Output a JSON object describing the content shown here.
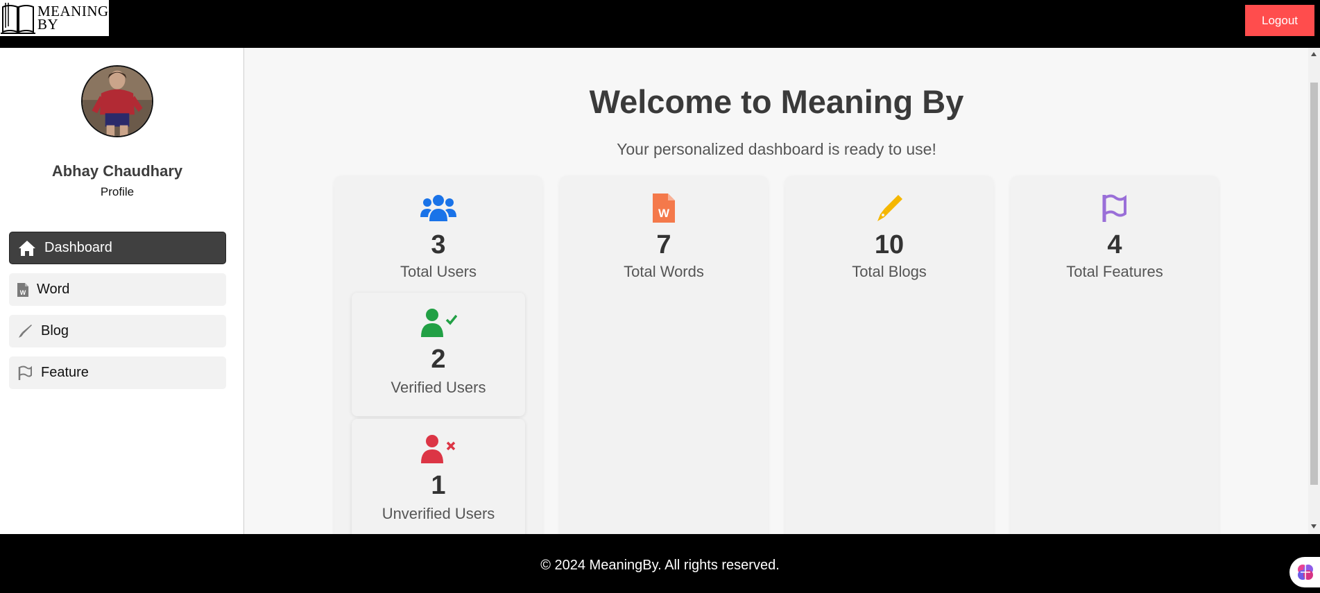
{
  "header": {
    "logo_line1": "MEANING",
    "logo_line2": "BY",
    "logout_label": "Logout"
  },
  "sidebar": {
    "user_name": "Abhay Chaudhary",
    "profile_label": "Profile",
    "items": [
      {
        "label": "Dashboard",
        "icon": "home-icon",
        "active": true
      },
      {
        "label": "Word",
        "icon": "word-file-icon",
        "active": false
      },
      {
        "label": "Blog",
        "icon": "pen-icon",
        "active": false
      },
      {
        "label": "Feature",
        "icon": "flag-icon",
        "active": false
      }
    ]
  },
  "main": {
    "title": "Welcome to Meaning By",
    "subtitle": "Your personalized dashboard is ready to use!",
    "stats": [
      {
        "value": "3",
        "label": "Total Users",
        "icon": "users-icon",
        "color": "#1a73e8"
      },
      {
        "value": "7",
        "label": "Total Words",
        "icon": "word-file-icon",
        "color": "#f4794b"
      },
      {
        "value": "10",
        "label": "Total Blogs",
        "icon": "pen-icon",
        "color": "#f5b700"
      },
      {
        "value": "4",
        "label": "Total Features",
        "icon": "flag-icon",
        "color": "#9a6fd8"
      }
    ],
    "user_breakdown": [
      {
        "value": "2",
        "label": "Verified Users",
        "icon": "user-check-icon",
        "color": "#22a045"
      },
      {
        "value": "1",
        "label": "Unverified Users",
        "icon": "user-x-icon",
        "color": "#dc3545"
      }
    ]
  },
  "footer": {
    "text": "© 2024 MeaningBy. All rights reserved."
  }
}
